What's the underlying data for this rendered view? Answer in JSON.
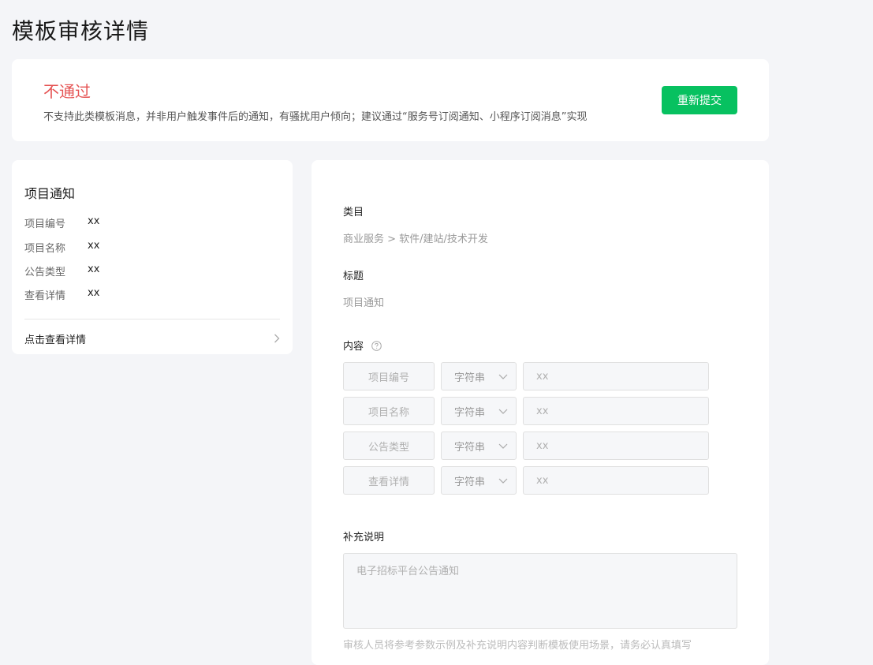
{
  "page": {
    "title": "模板审核详情"
  },
  "status": {
    "title": "不通过",
    "description": "不支持此类模板消息，并非用户触发事件后的通知，有骚扰用户倾向；建议通过“服务号订阅通知、小程序订阅消息”实现",
    "resubmit_label": "重新提交",
    "accent_color": "#e55353",
    "button_color": "#07c160"
  },
  "preview": {
    "title": "项目通知",
    "rows": [
      {
        "key": "项目编号",
        "value": "xx"
      },
      {
        "key": "项目名称",
        "value": "xx"
      },
      {
        "key": "公告类型",
        "value": "xx"
      },
      {
        "key": "查看详情",
        "value": "xx"
      }
    ],
    "link_label": "点击查看详情",
    "link_icon": "chevron-right-icon"
  },
  "detail": {
    "category_label": "类目",
    "category_value": "商业服务 > 软件/建站/技术开发",
    "title_label": "标题",
    "title_value": "项目通知",
    "content_label": "内容",
    "content_help_icon": "question-circle-icon",
    "fields": [
      {
        "name": "项目编号",
        "type": "字符串",
        "value": "xx"
      },
      {
        "name": "项目名称",
        "type": "字符串",
        "value": "xx"
      },
      {
        "name": "公告类型",
        "type": "字符串",
        "value": "xx"
      },
      {
        "name": "查看详情",
        "type": "字符串",
        "value": "xx"
      }
    ],
    "supplement_label": "补充说明",
    "supplement_value": "电子招标平台公告通知",
    "footnote": "审核人员将参考参数示例及补充说明内容判断模板使用场景，请务必认真填写"
  }
}
